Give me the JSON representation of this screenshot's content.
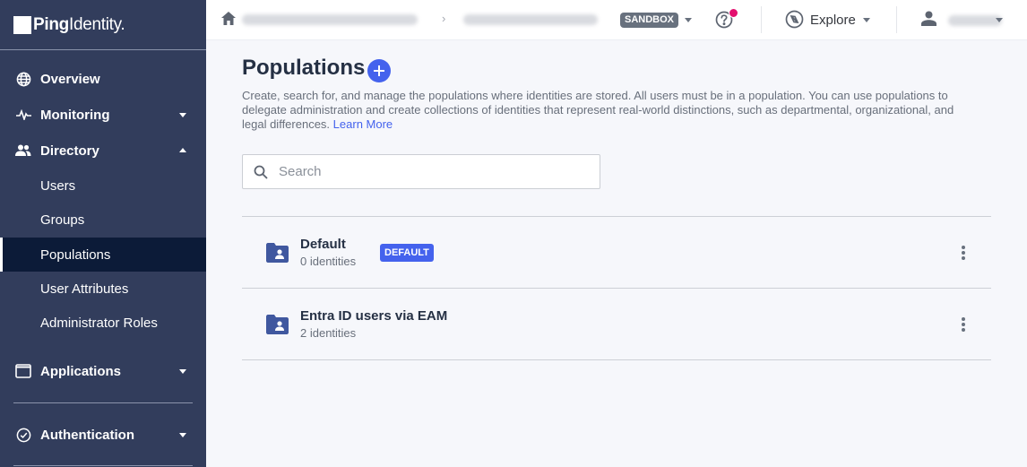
{
  "brand": {
    "logo_bold": "Ping",
    "logo_regular": "Identity",
    "logo_dot": "."
  },
  "sidebar": {
    "items": [
      {
        "label": "Overview",
        "icon": "globe-icon"
      },
      {
        "label": "Monitoring",
        "icon": "pulse-icon",
        "expanded": false
      },
      {
        "label": "Directory",
        "icon": "users-icon",
        "expanded": true,
        "children": [
          "Users",
          "Groups",
          "Populations",
          "User Attributes",
          "Administrator Roles"
        ],
        "active_child": "Populations"
      },
      {
        "label": "Applications",
        "icon": "window-icon",
        "expanded": false
      },
      {
        "label": "Authentication",
        "icon": "check-circle-icon",
        "expanded": false
      }
    ]
  },
  "header": {
    "environment_badge": "SANDBOX",
    "explore_label": "Explore",
    "help_has_notification": true,
    "colors": {
      "notification": "#e3106e"
    }
  },
  "main": {
    "title": "Populations",
    "description": "Create, search for, and manage the populations where identities are stored. All users must be in a population. You can use populations to delegate administration and create collections of identities that represent real-world distinctions, such as departmental, organizational, and legal differences.",
    "learn_more": "Learn More",
    "search": {
      "placeholder": "Search",
      "value": ""
    },
    "populations": [
      {
        "name": "Default",
        "count": "0 identities",
        "badge": "DEFAULT"
      },
      {
        "name": "Entra ID users via EAM",
        "count": "2 identities",
        "badge": null
      }
    ],
    "colors": {
      "accent": "#4462ed",
      "sidebar": "#323d5c",
      "sidebar_active": "#0c1b38"
    }
  }
}
